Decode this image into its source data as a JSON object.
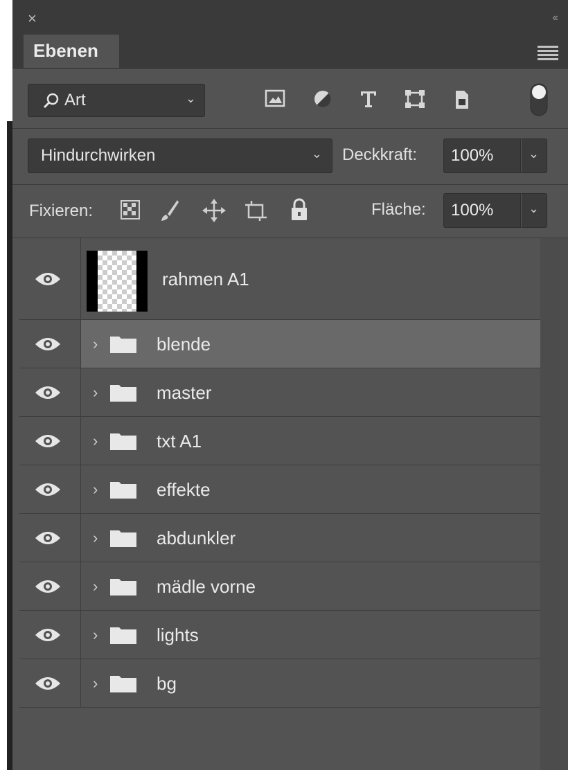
{
  "window": {
    "close_glyph": "×",
    "collapse_glyph": "‹‹"
  },
  "tabs": [
    {
      "label": "Ebenen"
    }
  ],
  "filter": {
    "label": "Art",
    "icons": [
      "image-filter-icon",
      "adjustment-filter-icon",
      "type-filter-icon",
      "shape-filter-icon",
      "smart-object-filter-icon"
    ]
  },
  "blend_mode": {
    "value": "Hindurchwirken"
  },
  "opacity": {
    "label": "Deckkraft:",
    "value": "100%"
  },
  "lock": {
    "label": "Fixieren:",
    "icons": [
      "lock-transparent-icon",
      "lock-pixels-icon",
      "lock-position-icon",
      "lock-artboard-icon",
      "lock-all-icon"
    ]
  },
  "fill": {
    "label": "Fläche:",
    "value": "100%"
  },
  "layers": [
    {
      "name": "rahmen A1",
      "type": "layer"
    },
    {
      "name": "blende",
      "type": "group",
      "selected": true
    },
    {
      "name": "master",
      "type": "group"
    },
    {
      "name": "txt A1",
      "type": "group"
    },
    {
      "name": "effekte",
      "type": "group"
    },
    {
      "name": "abdunkler",
      "type": "group"
    },
    {
      "name": "mädle vorne",
      "type": "group"
    },
    {
      "name": "lights",
      "type": "group"
    },
    {
      "name": "bg",
      "type": "group"
    }
  ],
  "colors": {
    "panel": "#535353",
    "selected_row": "#696969",
    "field": "#3b3b3b"
  }
}
